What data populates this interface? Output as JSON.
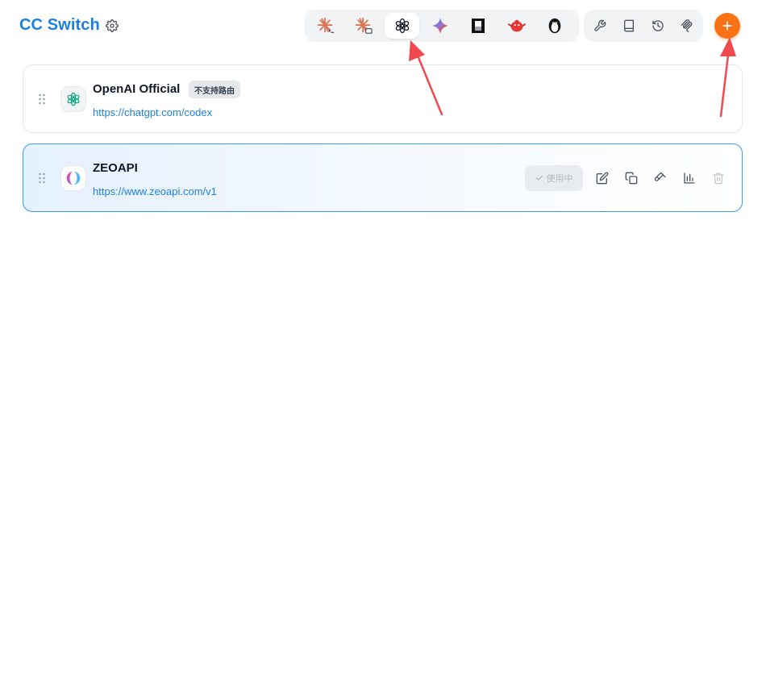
{
  "header": {
    "title": "CC Switch",
    "settings_icon": "gear-icon",
    "app_tabs": [
      {
        "id": "claude-code",
        "icon": "claude-code-icon",
        "active": false
      },
      {
        "id": "claude-desktop",
        "icon": "claude-desktop-icon",
        "active": false
      },
      {
        "id": "codex",
        "icon": "openai-icon",
        "active": true
      },
      {
        "id": "gemini",
        "icon": "gemini-icon",
        "active": false
      },
      {
        "id": "opencode",
        "icon": "opencode-icon",
        "active": false
      },
      {
        "id": "app-6",
        "icon": "red-creature-icon",
        "active": false
      },
      {
        "id": "app-7",
        "icon": "penguin-icon",
        "active": false
      }
    ],
    "tools": [
      {
        "id": "tools",
        "icon": "wrench-icon"
      },
      {
        "id": "docs",
        "icon": "book-icon"
      },
      {
        "id": "history",
        "icon": "history-icon"
      },
      {
        "id": "mcp",
        "icon": "mcp-icon"
      }
    ],
    "add_icon": "plus-icon"
  },
  "colors": {
    "brand": "#1d7fe0",
    "accent": "#f97316",
    "active_border": "#3b9cf0",
    "arrow": "#f0494f"
  },
  "providers": [
    {
      "name": "OpenAI Official",
      "badge": "不支持路由",
      "url": "https://chatgpt.com/codex",
      "icon": "openai-icon",
      "active": false
    },
    {
      "name": "ZEOAPI",
      "url": "https://www.zeoapi.com/v1",
      "icon": "zeoapi-logo-icon",
      "active": true,
      "status_label": "使用中",
      "actions": [
        "edit-icon",
        "duplicate-icon",
        "test-icon",
        "usage-icon",
        "delete-icon"
      ]
    }
  ]
}
